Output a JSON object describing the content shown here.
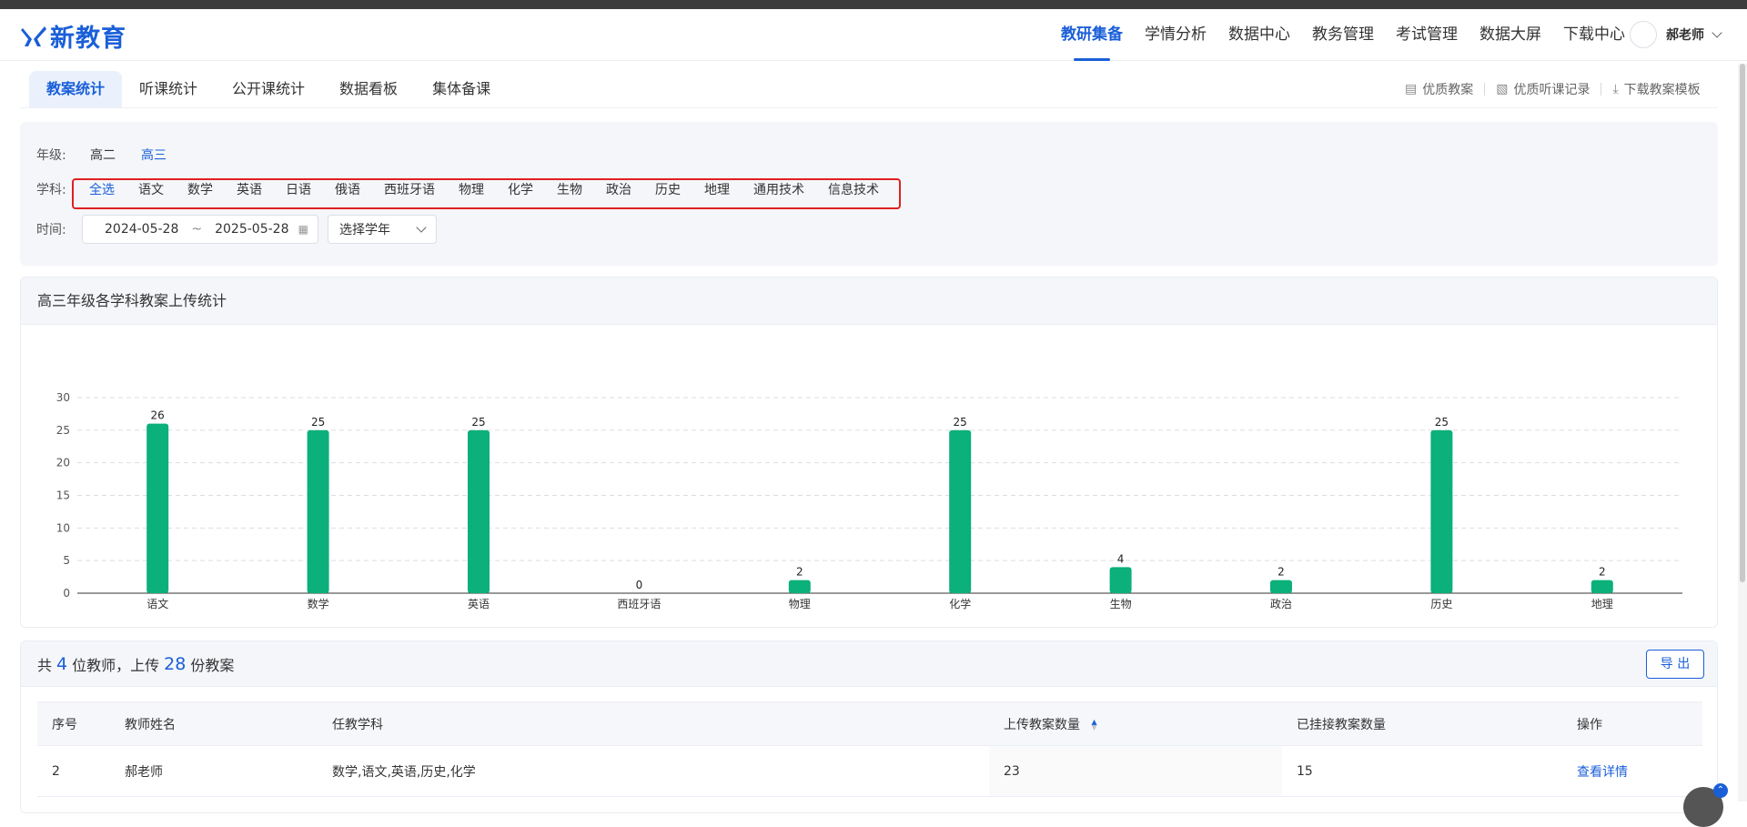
{
  "logo": {
    "text": "新教育"
  },
  "nav": {
    "items": [
      "教研集备",
      "学情分析",
      "数据中心",
      "教务管理",
      "考试管理",
      "数据大屏",
      "下载中心"
    ],
    "active": "教研集备"
  },
  "user": {
    "name": "郝老师"
  },
  "subtabs": {
    "items": [
      "教案统计",
      "听课统计",
      "公开课统计",
      "数据看板",
      "集体备课"
    ],
    "active": "教案统计"
  },
  "quick_links": {
    "items": [
      "优质教案",
      "优质听课记录",
      "下载教案模板"
    ]
  },
  "filters": {
    "grade_label": "年级:",
    "grades": [
      "高二",
      "高三"
    ],
    "grade_selected": "高三",
    "subject_label": "学科:",
    "subjects": [
      "全选",
      "语文",
      "数学",
      "英语",
      "日语",
      "俄语",
      "西班牙语",
      "物理",
      "化学",
      "生物",
      "政治",
      "历史",
      "地理",
      "通用技术",
      "信息技术"
    ],
    "subject_selected": "全选",
    "time_label": "时间:",
    "date_start": "2024-05-28",
    "date_sep": "~",
    "date_end": "2025-05-28",
    "year_placeholder": "选择学年"
  },
  "chart_title": "高三年级各学科教案上传统计",
  "chart_data": {
    "type": "bar",
    "title": "高三年级各学科教案上传统计",
    "categories": [
      "语文",
      "数学",
      "英语",
      "西班牙语",
      "物理",
      "化学",
      "生物",
      "政治",
      "历史",
      "地理"
    ],
    "values": [
      26,
      25,
      25,
      0,
      2,
      25,
      4,
      2,
      25,
      2
    ],
    "ylim": [
      0,
      30
    ],
    "yticks": [
      0,
      5,
      10,
      15,
      20,
      25,
      30
    ],
    "grid": true,
    "bar_color": "#0bb07b"
  },
  "summary": {
    "prefix": "共",
    "teachers": "4",
    "mid": "位教师，上传",
    "plans": "28",
    "suffix": "份教案"
  },
  "export_label": "导 出",
  "table": {
    "headers": [
      "序号",
      "教师姓名",
      "任教学科",
      "上传教案数量",
      "已挂接教案数量",
      "操作"
    ],
    "rows": [
      {
        "index": "2",
        "name": "郝老师",
        "subjects": "数学,语文,英语,历史,化学",
        "uploaded": "23",
        "linked": "15",
        "action": "查看详情"
      }
    ]
  },
  "colors": {
    "accent": "#1a5fd8",
    "bar": "#0bb07b",
    "highlight": "#e02020"
  }
}
